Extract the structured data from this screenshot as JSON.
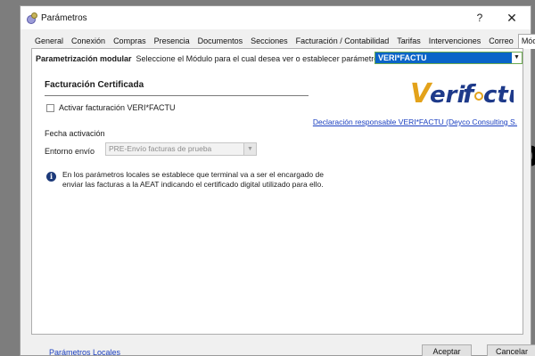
{
  "window": {
    "title": "Parámetros",
    "help_label": "?",
    "close_label": "✕"
  },
  "background_text": "p",
  "tabs": [
    {
      "label": "General",
      "active": false
    },
    {
      "label": "Conexión",
      "active": false
    },
    {
      "label": "Compras",
      "active": false
    },
    {
      "label": "Presencia",
      "active": false
    },
    {
      "label": "Documentos",
      "active": false
    },
    {
      "label": "Secciones",
      "active": false
    },
    {
      "label": "Facturación / Contabilidad",
      "active": false
    },
    {
      "label": "Tarifas",
      "active": false
    },
    {
      "label": "Intervenciones",
      "active": false
    },
    {
      "label": "Correo",
      "active": false
    },
    {
      "label": "Módulos",
      "active": true
    }
  ],
  "module": {
    "label": "Parametrización modular",
    "prompt": "Seleccione el Módulo para el cual desea ver o establecer parámetros:",
    "selected": "VERI*FACTU"
  },
  "section": {
    "title": "Facturación Certificada",
    "checkbox_label": "Activar facturación VERI*FACTU",
    "checkbox_checked": false,
    "fecha_label": "Fecha activación",
    "entorno_label": "Entorno envío",
    "entorno_value": "PRE-Envío facturas de prueba",
    "declaration_link": "Declaración responsable VERI*FACTU (Deyco Consulting S.",
    "info_text": "En los parámetros locales se establece que terminal va a ser el encargado de enviar las facturas a la AEAT indicando el certificado digital utilizado para ello."
  },
  "logo": {
    "text_veri": "Veri",
    "text_f": "f",
    "text_ctu": "ctu",
    "color_blue": "#1e3a8a",
    "color_gold": "#e3a21a"
  },
  "footer": {
    "local_params_link": "Parámetros Locales",
    "accept_label": "Aceptar",
    "cancel_label": "Cancelar"
  }
}
